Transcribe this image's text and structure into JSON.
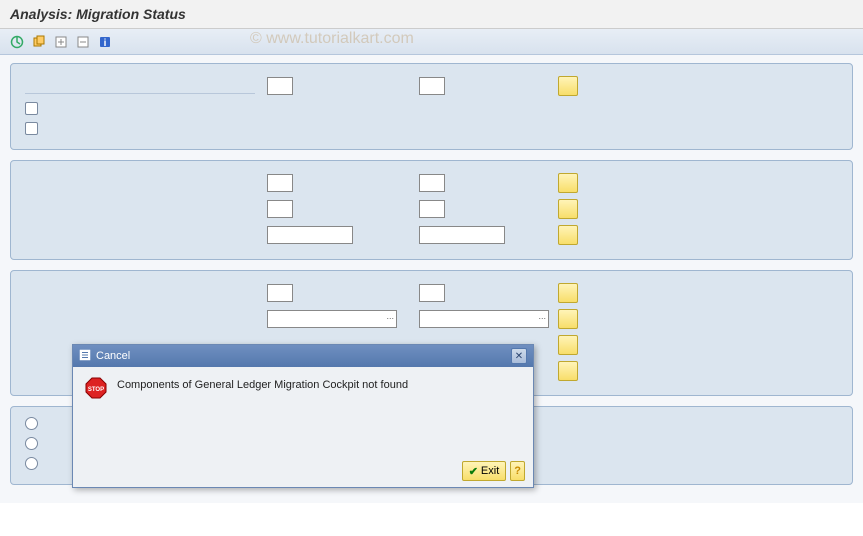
{
  "title": "Analysis: Migration Status",
  "watermark": "© www.tutorialkart.com",
  "toolbar_icons": [
    "execute-icon",
    "get-variant-icon",
    "expand-icon",
    "collapse-icon",
    "info-icon"
  ],
  "dialog": {
    "title": "Cancel",
    "message": "Components of General Ledger Migration Cockpit not found",
    "exit_label": "Exit"
  }
}
